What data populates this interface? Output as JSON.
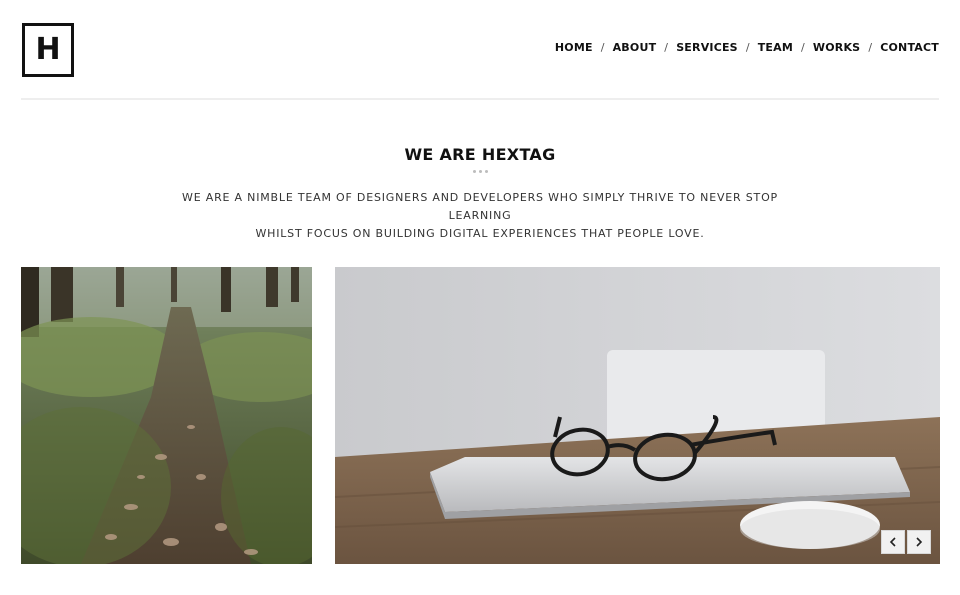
{
  "brand": {
    "logo_letter": "H"
  },
  "nav": {
    "items": [
      {
        "label": "HOME"
      },
      {
        "label": "ABOUT"
      },
      {
        "label": "SERVICES"
      },
      {
        "label": "TEAM"
      },
      {
        "label": "WORKS"
      },
      {
        "label": "CONTACT"
      }
    ],
    "separator": "/"
  },
  "intro": {
    "title": "WE ARE HEXTAG",
    "line1": "WE ARE A NIMBLE TEAM OF DESIGNERS AND DEVELOPERS WHO SIMPLY THRIVE TO NEVER STOP LEARNING",
    "line2": "WHILST FOCUS ON BUILDING DIGITAL EXPERIENCES THAT PEOPLE LOVE."
  },
  "gallery": {
    "left_image": "forest-path-photo",
    "right_image": "laptop-glasses-mouse-photo",
    "prev_icon": "chevron-left-icon",
    "next_icon": "chevron-right-icon"
  },
  "colors": {
    "text": "#111111",
    "rule": "#eeeeee",
    "dots": "#bdbdbd"
  }
}
